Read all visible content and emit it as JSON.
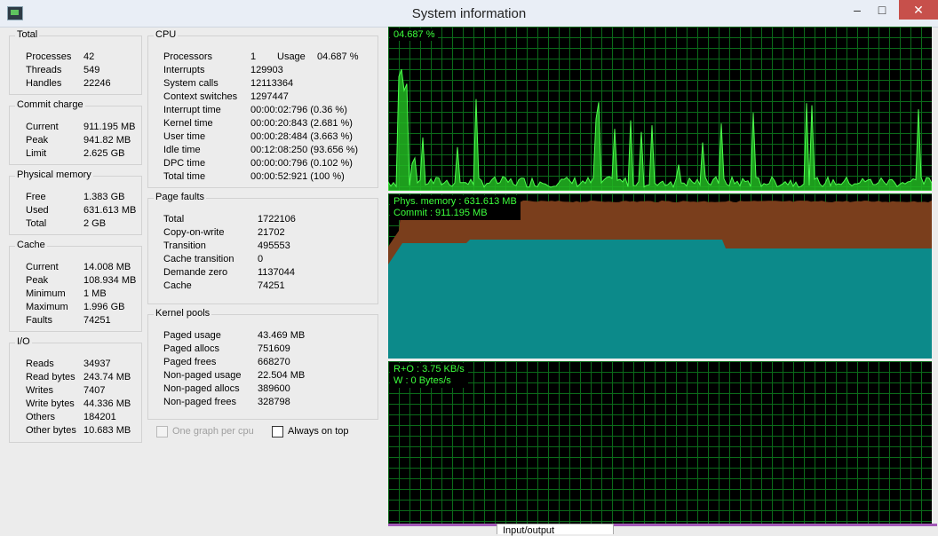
{
  "window": {
    "title": "System information",
    "minimize": "‒",
    "maximize": "□",
    "close": "✕"
  },
  "total": {
    "title": "Total",
    "rows": [
      {
        "label": "Processes",
        "value": "42"
      },
      {
        "label": "Threads",
        "value": "549"
      },
      {
        "label": "Handles",
        "value": "22246"
      }
    ]
  },
  "commit": {
    "title": "Commit charge",
    "rows": [
      {
        "label": "Current",
        "value": "911.195 MB"
      },
      {
        "label": "Peak",
        "value": "941.82 MB"
      },
      {
        "label": "Limit",
        "value": "2.625 GB"
      }
    ]
  },
  "physical": {
    "title": "Physical memory",
    "rows": [
      {
        "label": "Free",
        "value": "1.383 GB"
      },
      {
        "label": "Used",
        "value": "631.613 MB"
      },
      {
        "label": "Total",
        "value": "2 GB"
      }
    ]
  },
  "cache": {
    "title": "Cache",
    "rows": [
      {
        "label": "Current",
        "value": "14.008 MB"
      },
      {
        "label": "Peak",
        "value": "108.934 MB"
      },
      {
        "label": "Minimum",
        "value": "1 MB"
      },
      {
        "label": "Maximum",
        "value": "1.996 GB"
      },
      {
        "label": "Faults",
        "value": "74251"
      }
    ]
  },
  "io": {
    "title": "I/O",
    "rows": [
      {
        "label": "Reads",
        "value": "34937"
      },
      {
        "label": "Read bytes",
        "value": "243.74 MB"
      },
      {
        "label": "Writes",
        "value": "7407"
      },
      {
        "label": "Write bytes",
        "value": "44.336 MB"
      },
      {
        "label": "Others",
        "value": "184201"
      },
      {
        "label": "Other bytes",
        "value": "10.683 MB"
      }
    ]
  },
  "cpu": {
    "title": "CPU",
    "usage_label": "Usage",
    "usage_value": "04.687 %",
    "rows": [
      {
        "label": "Processors",
        "value": "1"
      },
      {
        "label": "Interrupts",
        "value": "129903"
      },
      {
        "label": "System calls",
        "value": "12113364"
      },
      {
        "label": "Context switches",
        "value": "1297447"
      },
      {
        "label": "Interrupt time",
        "value": "00:00:02:796 (0.36 %)"
      },
      {
        "label": "Kernel time",
        "value": "00:00:20:843 (2.681 %)"
      },
      {
        "label": "User time",
        "value": "00:00:28:484 (3.663 %)"
      },
      {
        "label": "Idle time",
        "value": "00:12:08:250 (93.656 %)"
      },
      {
        "label": "DPC time",
        "value": "00:00:00:796 (0.102 %)"
      },
      {
        "label": "Total time",
        "value": "00:00:52:921 (100 %)"
      }
    ]
  },
  "pagefaults": {
    "title": "Page faults",
    "rows": [
      {
        "label": "Total",
        "value": "1722106"
      },
      {
        "label": "Copy-on-write",
        "value": "21702"
      },
      {
        "label": "Transition",
        "value": "495553"
      },
      {
        "label": "Cache transition",
        "value": "0"
      },
      {
        "label": "Demande zero",
        "value": "1137044"
      },
      {
        "label": "Cache",
        "value": "74251"
      }
    ]
  },
  "kernelpools": {
    "title": "Kernel pools",
    "rows": [
      {
        "label": "Paged usage",
        "value": "43.469 MB"
      },
      {
        "label": "Paged allocs",
        "value": "751609"
      },
      {
        "label": "Paged frees",
        "value": "668270"
      },
      {
        "label": "Non-paged usage",
        "value": "22.504 MB"
      },
      {
        "label": "Non-paged allocs",
        "value": "389600"
      },
      {
        "label": "Non-paged frees",
        "value": "328798"
      }
    ]
  },
  "options": {
    "one_graph": "One graph per cpu",
    "always_on_top": "Always on top"
  },
  "graphs": {
    "cpu_label": "04.687 %",
    "mem_label1": "Phys. memory : 631.613 MB",
    "mem_label2": "Commit : 911.195 MB",
    "io_label1": "R+O : 3.75 KB/s",
    "io_label2": "W : 0 Bytes/s",
    "colors": {
      "cpu": "#33dd33",
      "commit": "#7a3e1c",
      "phys": "#0c8a8a",
      "grid": "#0b6b1a",
      "label": "#3cff3c"
    }
  },
  "bottom_tab": "Input/output"
}
